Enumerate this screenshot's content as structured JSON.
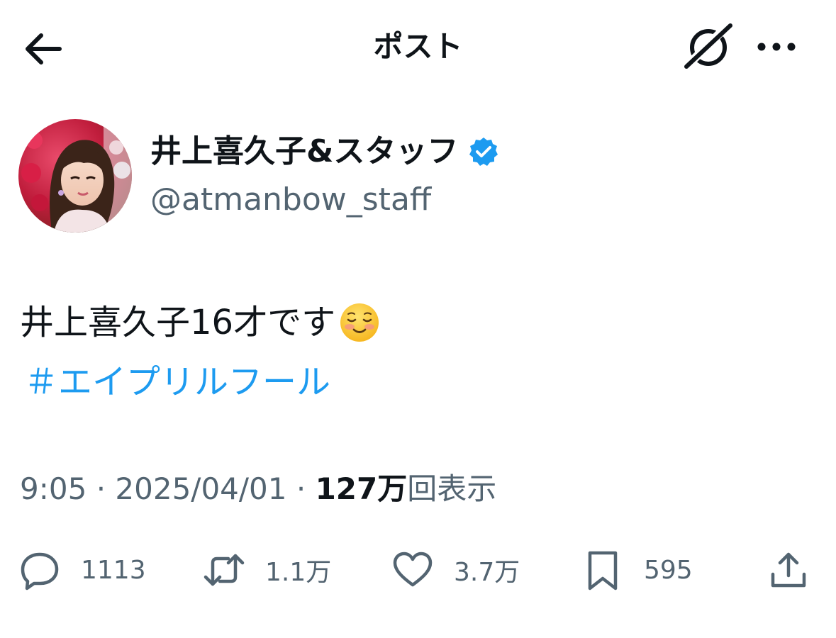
{
  "header": {
    "title": "ポスト"
  },
  "author": {
    "display_name": "井上喜久子&スタッフ",
    "handle": "@atmanbow_staff",
    "verified": true
  },
  "tweet": {
    "text": "井上喜久子16才です",
    "hashtag": "＃エイプリルフール"
  },
  "meta": {
    "time": "9:05",
    "separator": "·",
    "date": "2025/04/01",
    "views_count": "127万",
    "views_label": "回表示"
  },
  "actions": {
    "replies": "1113",
    "retweets": "1.1万",
    "likes": "3.7万",
    "bookmarks": "595"
  },
  "colors": {
    "accent": "#1d9bf0",
    "text": "#0f1419",
    "secondary": "#536471"
  }
}
